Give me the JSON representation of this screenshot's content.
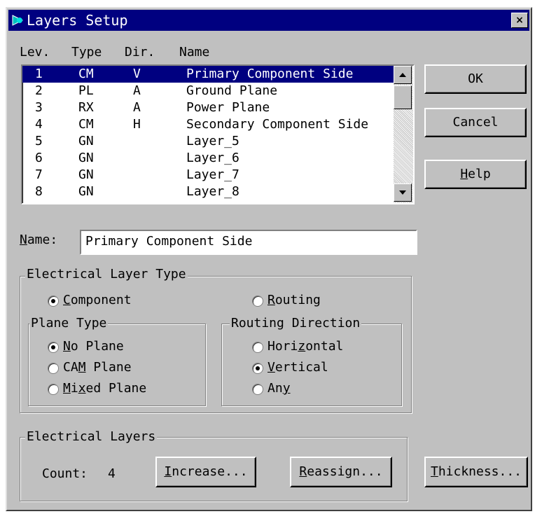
{
  "window": {
    "title": "Layers Setup",
    "close_label": "×"
  },
  "list": {
    "headers": {
      "lev": "Lev.",
      "type": "Type",
      "dir": "Dir.",
      "name": "Name"
    },
    "rows": [
      {
        "lev": "1",
        "type": "CM",
        "dir": "V",
        "name": "Primary Component Side"
      },
      {
        "lev": "2",
        "type": "PL",
        "dir": "A",
        "name": "Ground Plane"
      },
      {
        "lev": "3",
        "type": "RX",
        "dir": "A",
        "name": "Power Plane"
      },
      {
        "lev": "4",
        "type": "CM",
        "dir": "H",
        "name": "Secondary Component Side"
      },
      {
        "lev": "5",
        "type": "GN",
        "dir": "",
        "name": "Layer_5"
      },
      {
        "lev": "6",
        "type": "GN",
        "dir": "",
        "name": "Layer_6"
      },
      {
        "lev": "7",
        "type": "GN",
        "dir": "",
        "name": "Layer_7"
      },
      {
        "lev": "8",
        "type": "GN",
        "dir": "",
        "name": "Layer_8"
      }
    ],
    "selected_index": 0
  },
  "buttons": {
    "ok": "OK",
    "cancel": "Cancel",
    "help_u": "H",
    "help_rest": "elp",
    "increase_u": "I",
    "increase_rest": "ncrease...",
    "reassign_u": "R",
    "reassign_rest": "eassign...",
    "thickness_u": "T",
    "thickness_rest": "hickness..."
  },
  "name_field": {
    "label_u": "N",
    "label_rest": "ame:",
    "value": "Primary Component Side"
  },
  "electrical_layer_type": {
    "title": "Electrical  Layer Type",
    "component_u": "C",
    "component_rest": "omponent",
    "component_checked": true,
    "routing_u": "R",
    "routing_rest": "outing",
    "routing_checked": false,
    "plane_type": {
      "title": "Plane Type",
      "no_plane_u": "N",
      "no_plane_rest": "o Plane",
      "no_plane_checked": true,
      "cam_plane_pre": "CA",
      "cam_plane_u": "M",
      "cam_plane_rest": " Plane",
      "cam_plane_checked": false,
      "mixed_plane_u": "M",
      "mixed_plane_mid": "i",
      "mixed_plane_u2": "x",
      "mixed_plane_rest": "ed Plane",
      "mixed_plane_checked": false
    },
    "routing_direction": {
      "title": "Routing Direction",
      "horizontal_pre": "Hori",
      "horizontal_u": "z",
      "horizontal_rest": "ontal",
      "horizontal_checked": false,
      "vertical_u": "V",
      "vertical_rest": "ertical",
      "vertical_checked": true,
      "any_pre": "An",
      "any_u": "y",
      "any_checked": false
    }
  },
  "electrical_layers": {
    "title": "Electrical Layers",
    "count_label": "Count:",
    "count_value": "4"
  },
  "icons": {
    "app": "app-icon",
    "scroll_up": "up-arrow-icon",
    "scroll_down": "down-arrow-icon"
  },
  "colors": {
    "titlebar": "#000080",
    "face": "#c0c0c0",
    "selection": "#000080"
  }
}
